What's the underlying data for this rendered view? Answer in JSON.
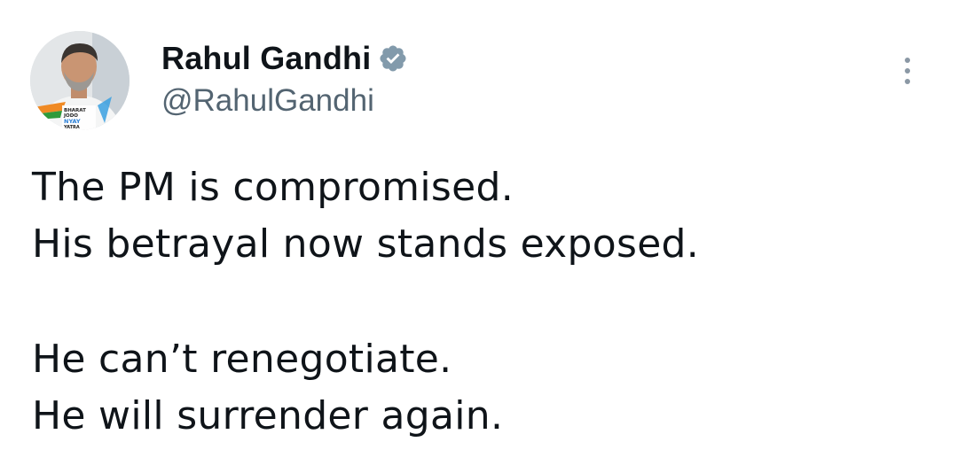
{
  "tweet": {
    "author": {
      "display_name": "Rahul Gandhi",
      "handle": "@RahulGandhi",
      "verified_icon": "verified-badge-icon",
      "avatar_badge_text": [
        "BHARAT",
        "JODO",
        "NYAY",
        "YATRA"
      ]
    },
    "menu_icon": "more-options-icon",
    "paragraphs": [
      [
        "The PM is compromised.",
        "His betrayal now stands exposed."
      ],
      [
        "He can’t renegotiate.",
        "He will surrender again."
      ]
    ]
  },
  "colors": {
    "text": "#0f1419",
    "secondary_text": "#536471",
    "verified_badge": "#829aab",
    "background": "#ffffff"
  }
}
